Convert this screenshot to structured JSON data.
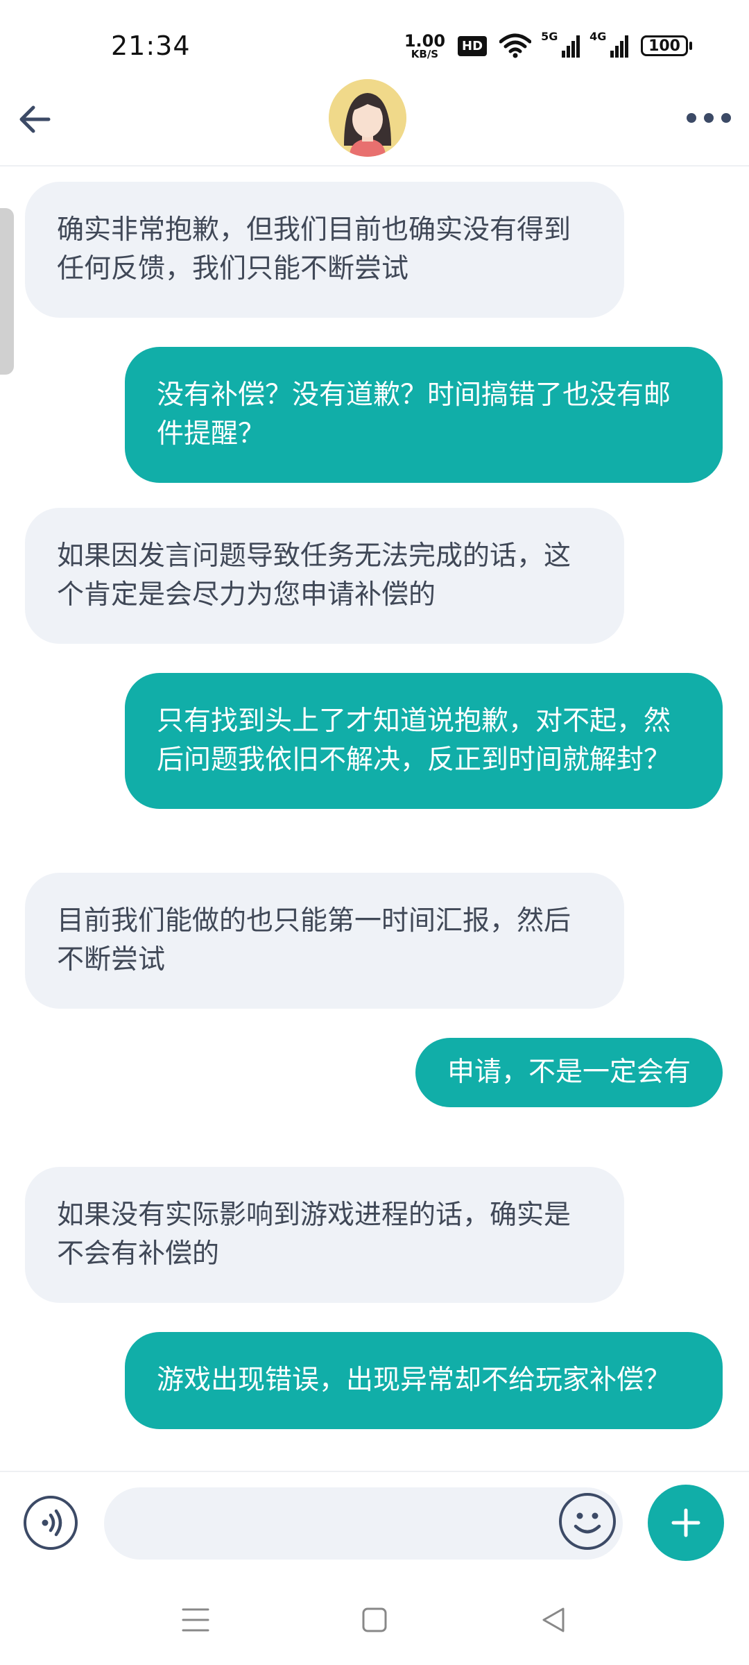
{
  "status_bar": {
    "time": "21:34",
    "net_speed_value": "1.00",
    "net_speed_unit": "KB/S",
    "hd_label": "HD",
    "signal_1_tag": "5G",
    "signal_2_tag": "4G",
    "battery": "100"
  },
  "colors": {
    "accent": "#11aea8",
    "incoming_bubble": "#eff2f7",
    "icon": "#3c4a66"
  },
  "messages": [
    {
      "from": "them",
      "text": "确实非常抱歉，但我们目前也确实没有得到任何反馈，我们只能不断尝试"
    },
    {
      "from": "me",
      "text": "没有补偿？没有道歉？时间搞错了也没有邮件提醒？"
    },
    {
      "from": "them",
      "text": "如果因发言问题导致任务无法完成的话，这个肯定是会尽力为您申请补偿的"
    },
    {
      "from": "me",
      "text": "只有找到头上了才知道说抱歉，对不起，然后问题我依旧不解决，反正到时间就解封？"
    },
    {
      "from": "them",
      "text": "目前我们能做的也只能第一时间汇报，然后不断尝试"
    },
    {
      "from": "me",
      "text": "申请，不是一定会有"
    },
    {
      "from": "them",
      "text": "如果没有实际影响到游戏进程的话，确实是不会有补偿的"
    },
    {
      "from": "me",
      "text": "游戏出现错误，出现异常却不给玩家补偿？"
    }
  ],
  "input": {
    "value": "",
    "placeholder": ""
  }
}
